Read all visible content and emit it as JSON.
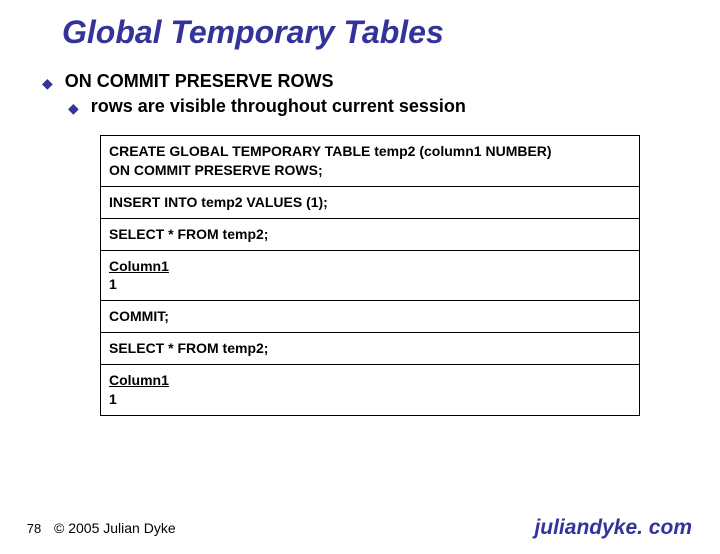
{
  "title": "Global Temporary Tables",
  "bullets": {
    "top": "ON COMMIT PRESERVE ROWS",
    "sub": "rows are visible throughout current session"
  },
  "code": {
    "s1": "CREATE GLOBAL TEMPORARY TABLE temp2 (column1 NUMBER)\nON COMMIT PRESERVE ROWS;",
    "s2": "INSERT INTO temp2 VALUES (1);",
    "s3": "SELECT * FROM temp2;",
    "s4_header": "Column1",
    "s4_row": "1",
    "s5": "COMMIT;",
    "s6": "SELECT * FROM temp2;",
    "s7_header": "Column1",
    "s7_row": "1"
  },
  "footer": {
    "page": "78",
    "copyright": "© 2005 Julian Dyke",
    "site": "juliandyke. com"
  }
}
